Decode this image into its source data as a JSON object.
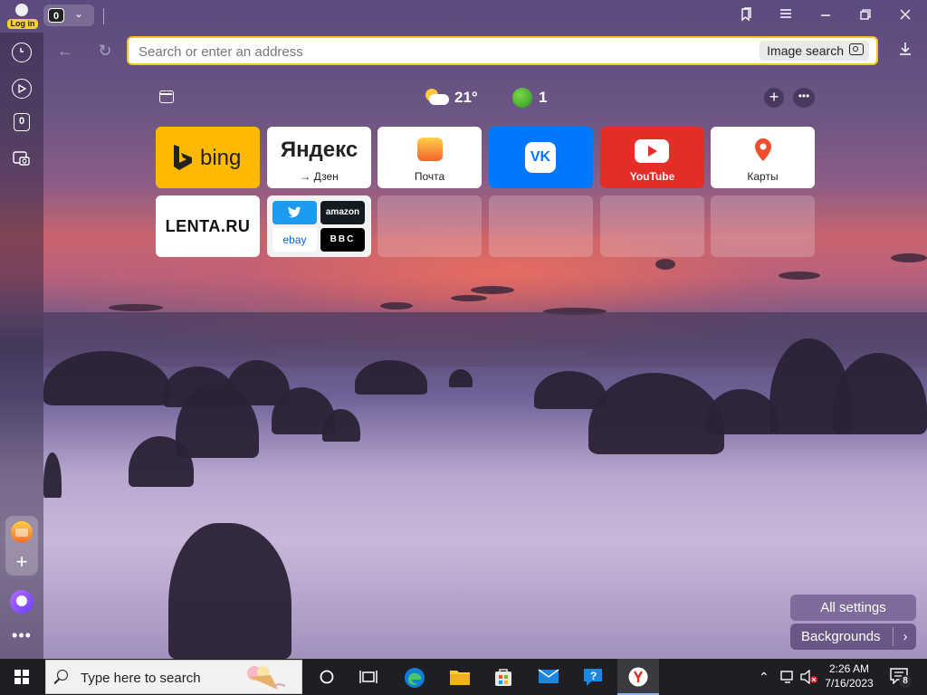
{
  "account": {
    "login_label": "Log in"
  },
  "tabs": {
    "count": "0"
  },
  "sidebar": {
    "counter": "0",
    "more": "•••"
  },
  "address_bar": {
    "placeholder": "Search or enter an address",
    "image_search_label": "Image search"
  },
  "info_row": {
    "temperature": "21°",
    "ball_count": "1"
  },
  "tiles": [
    {
      "name": "bing",
      "text": "bing"
    },
    {
      "name": "yandex",
      "title": "Яндекс",
      "subtitle": "→ Дзен"
    },
    {
      "name": "mail",
      "label": "Почта"
    },
    {
      "name": "vk",
      "text": "VK"
    },
    {
      "name": "youtube",
      "label": "YouTube"
    },
    {
      "name": "maps",
      "label": "Карты"
    },
    {
      "name": "lenta",
      "text": "LENTA.RU"
    },
    {
      "name": "multi",
      "items": [
        "twitter",
        "amazon",
        "ebay",
        "BBC"
      ]
    }
  ],
  "bottom_buttons": {
    "all_settings": "All settings",
    "backgrounds": "Backgrounds"
  },
  "taskbar": {
    "search_placeholder": "Type here to search",
    "time": "2:26 AM",
    "date": "7/16/2023",
    "notification_count": "8"
  },
  "colors": {
    "accent": "#f3c619",
    "youtube": "#e52d27",
    "vk": "#0077ff",
    "bing": "#ffb900"
  }
}
